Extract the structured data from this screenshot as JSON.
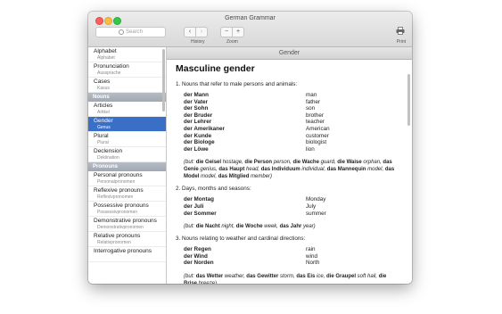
{
  "window": {
    "title": "German Grammar"
  },
  "toolbar": {
    "search_placeholder": "Search",
    "history_back": "‹",
    "history_forward": "›",
    "history_label": "History",
    "zoom_out": "−",
    "zoom_in": "+",
    "zoom_label": "Zoom",
    "print_label": "Print"
  },
  "sidebar": {
    "items": [
      {
        "type": "item",
        "label": "Alphabet",
        "sub": "Alphabet",
        "selected": false
      },
      {
        "type": "item",
        "label": "Pronunciation",
        "sub": "Aussprache",
        "selected": false
      },
      {
        "type": "item",
        "label": "Cases",
        "sub": "Kasus",
        "selected": false
      },
      {
        "type": "section",
        "label": "Nouns"
      },
      {
        "type": "item",
        "label": "Articles",
        "sub": "Artikel",
        "selected": false
      },
      {
        "type": "item",
        "label": "Gender",
        "sub": "Genus",
        "selected": true
      },
      {
        "type": "item",
        "label": "Plural",
        "sub": "Plural",
        "selected": false
      },
      {
        "type": "item",
        "label": "Declension",
        "sub": "Deklination",
        "selected": false
      },
      {
        "type": "section",
        "label": "Pronouns"
      },
      {
        "type": "item",
        "label": "Personal pronouns",
        "sub": "Personalpronomen",
        "selected": false
      },
      {
        "type": "item",
        "label": "Reflexive pronouns",
        "sub": "Reflexivpronomen",
        "selected": false
      },
      {
        "type": "item",
        "label": "Possessive pronouns",
        "sub": "Possessivpronomen",
        "selected": false
      },
      {
        "type": "item",
        "label": "Demonstrative pronouns",
        "sub": "Demonstrativpronomen",
        "selected": false
      },
      {
        "type": "item",
        "label": "Relative pronouns",
        "sub": "Relativpronomen",
        "selected": false
      },
      {
        "type": "item",
        "label": "Interrogative pronouns",
        "sub": "",
        "selected": false
      }
    ]
  },
  "content": {
    "header": "Gender",
    "title": "Masculine gender",
    "sections": [
      {
        "heading": "1. Nouns that refer to male persons and animals:",
        "words": [
          {
            "de": "der Mann",
            "en": "man"
          },
          {
            "de": "der Vater",
            "en": "father"
          },
          {
            "de": "der Sohn",
            "en": "son"
          },
          {
            "de": "der Bruder",
            "en": "brother"
          },
          {
            "de": "der Lehrer",
            "en": "teacher"
          },
          {
            "de": "der Amerikaner",
            "en": "American"
          },
          {
            "de": "der Kunde",
            "en": "customer"
          },
          {
            "de": "der Biologe",
            "en": "biologist"
          },
          {
            "de": "der Löwe",
            "en": "lion"
          }
        ],
        "note": [
          {
            "t": "(but: ",
            "s": "i"
          },
          {
            "t": "die Geisel",
            "s": "b"
          },
          {
            "t": " hostage, ",
            "s": "i"
          },
          {
            "t": "die Person",
            "s": "b"
          },
          {
            "t": " person, ",
            "s": "i"
          },
          {
            "t": "die Wache",
            "s": "b"
          },
          {
            "t": " guard, ",
            "s": "i"
          },
          {
            "t": "die Waise",
            "s": "b"
          },
          {
            "t": " orphan, ",
            "s": "i"
          },
          {
            "t": "das Genie",
            "s": "b"
          },
          {
            "t": " genius, ",
            "s": "i"
          },
          {
            "t": "das Haupt",
            "s": "b"
          },
          {
            "t": " head, ",
            "s": "i"
          },
          {
            "t": "das Individuum",
            "s": "b"
          },
          {
            "t": " individual, ",
            "s": "i"
          },
          {
            "t": "das Mannequin",
            "s": "b"
          },
          {
            "t": " model, ",
            "s": "i"
          },
          {
            "t": "das Model",
            "s": "b"
          },
          {
            "t": " model, ",
            "s": "i"
          },
          {
            "t": "das Mitglied",
            "s": "b"
          },
          {
            "t": " member)",
            "s": "i"
          }
        ]
      },
      {
        "heading": "2. Days, months and seasons:",
        "words": [
          {
            "de": "der Montag",
            "en": "Monday"
          },
          {
            "de": "der Juli",
            "en": "July"
          },
          {
            "de": "der Sommer",
            "en": "summer"
          }
        ],
        "note": [
          {
            "t": "(but: ",
            "s": "i"
          },
          {
            "t": "die Nacht",
            "s": "b"
          },
          {
            "t": " night, ",
            "s": "i"
          },
          {
            "t": "die Woche",
            "s": "b"
          },
          {
            "t": " week, ",
            "s": "i"
          },
          {
            "t": "das Jahr",
            "s": "b"
          },
          {
            "t": " year)",
            "s": "i"
          }
        ]
      },
      {
        "heading": "3. Nouns relating to weather and cardinal directions:",
        "words": [
          {
            "de": "der Regen",
            "en": "rain"
          },
          {
            "de": "der Wind",
            "en": "wind"
          },
          {
            "de": "der Norden",
            "en": "North"
          }
        ],
        "note": [
          {
            "t": "(but: ",
            "s": "i"
          },
          {
            "t": "das Wetter",
            "s": "b"
          },
          {
            "t": " weather, ",
            "s": "i"
          },
          {
            "t": "das Gewitter",
            "s": "b"
          },
          {
            "t": " storm, ",
            "s": "i"
          },
          {
            "t": "das Eis",
            "s": "b"
          },
          {
            "t": " ice, ",
            "s": "i"
          },
          {
            "t": "die Graupel",
            "s": "b"
          },
          {
            "t": " soft hail, ",
            "s": "i"
          },
          {
            "t": "die Brise",
            "s": "b"
          },
          {
            "t": " breeze)",
            "s": "i"
          }
        ]
      }
    ]
  },
  "colors": {
    "selection": "#3a6fc7",
    "section_header": "#a9b0ba"
  }
}
